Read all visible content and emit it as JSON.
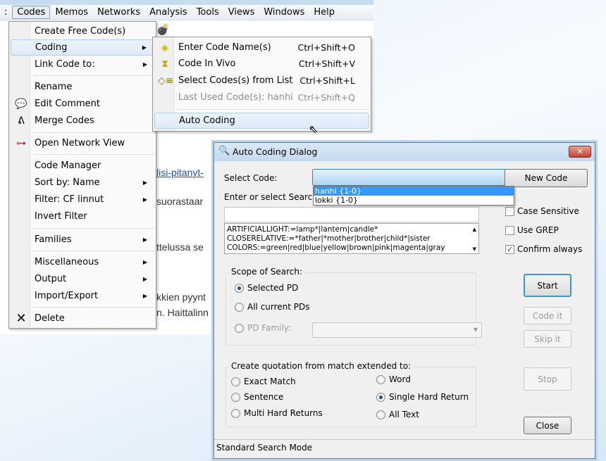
{
  "menubar": {
    "items": [
      "Codes",
      "Memos",
      "Networks",
      "Analysis",
      "Tools",
      "Views",
      "Windows",
      "Help"
    ],
    "active": "Codes"
  },
  "background_text": {
    "t1": "suorastaar",
    "t2": "ttelussa se",
    "t3": "kkien pyynt",
    "t4": "n. Haittalinn",
    "link": "lisi-pitanyt-"
  },
  "codes_menu": {
    "items": [
      {
        "label": "Create Free Code(s)"
      },
      {
        "label": "Coding",
        "submenu": true
      },
      {
        "label": "Link Code to:",
        "submenu": true
      },
      {
        "label": "Rename"
      },
      {
        "label": "Edit Comment",
        "icon": "comment-icon"
      },
      {
        "label": "Merge Codes",
        "icon": "merge-icon"
      },
      {
        "label": "Open Network View",
        "icon": "network-icon"
      },
      {
        "label": "Code Manager"
      },
      {
        "label": "Sort by: Name",
        "submenu": true
      },
      {
        "label": "Filter: CF linnut",
        "submenu": true
      },
      {
        "label": "Invert Filter"
      },
      {
        "label": "Families",
        "submenu": true
      },
      {
        "label": "Miscellaneous",
        "submenu": true
      },
      {
        "label": "Output",
        "submenu": true
      },
      {
        "label": "Import/Export",
        "submenu": true
      },
      {
        "label": "Delete",
        "icon": "delete-icon"
      }
    ]
  },
  "coding_submenu": {
    "items": [
      {
        "label": "Enter Code Name(s)",
        "shortcut": "Ctrl+Shift+O",
        "icon": "code-name-icon"
      },
      {
        "label": "Code In Vivo",
        "shortcut": "Ctrl+Shift+V",
        "icon": "in-vivo-icon"
      },
      {
        "label": "Select Codes(s) from List",
        "shortcut": "Ctrl+Shift+L",
        "icon": "code-list-icon"
      },
      {
        "label": "Last Used Code(s): hanhi",
        "shortcut": "Ctrl+Shift+Q",
        "disabled": true
      },
      {
        "label": "Auto Coding"
      }
    ]
  },
  "dialog": {
    "title": "Auto Coding Dialog",
    "select_code_label": "Select Code:",
    "select_code_value": "",
    "code_options": [
      "hanhi {1-0}",
      "lokki {1-0}"
    ],
    "new_code": "New Code",
    "search_label": "Enter or select Search Ex",
    "search_value": "",
    "expressions": [
      "ARTIFICIALLIGHT:=lamp*|lantern|candle*",
      "CLOSERELATIVE:=*father|*mother|brother|child*|sister",
      "COLORS:=green|red|blue|yellow|brown|pink|magenta|gray"
    ],
    "case_sensitive": {
      "label": "Case Sensitive",
      "checked": false
    },
    "use_grep": {
      "label": "Use GREP",
      "checked": false
    },
    "confirm_always": {
      "label": "Confirm always",
      "checked": true
    },
    "scope": {
      "title": "Scope of Search:",
      "selected_pd": "Selected PD",
      "all_pds": "All current PDs",
      "pd_family": "PD Family:",
      "selected": "Selected PD"
    },
    "quotation": {
      "title": "Create quotation from match extended to:",
      "options": [
        "Exact Match",
        "Sentence",
        "Multi Hard Returns",
        "Word",
        "Single Hard Return",
        "All Text"
      ],
      "selected": "Single Hard Return"
    },
    "buttons": {
      "start": "Start",
      "code_it": "Code it",
      "skip_it": "Skip it",
      "stop": "Stop",
      "close": "Close"
    },
    "status": "Standard Search Mode"
  },
  "colors": {
    "highlight": "#3399ff",
    "accent": "#3c97cf"
  }
}
